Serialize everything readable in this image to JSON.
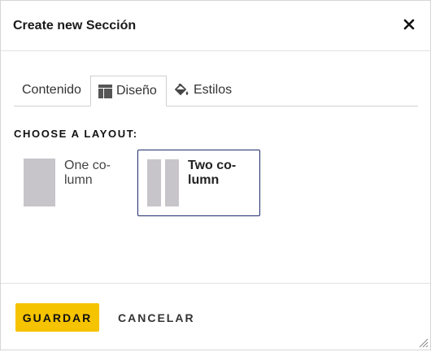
{
  "dialog": {
    "title": "Create new Sección",
    "close_icon": "close-icon"
  },
  "tabs": [
    {
      "label": "Contenido",
      "icon": null
    },
    {
      "label": "Diseño",
      "icon": "layout-icon",
      "active": true
    },
    {
      "label": "Estilos",
      "icon": "paint-bucket-icon"
    }
  ],
  "layout_section": {
    "heading": "CHOOSE A LAYOUT:",
    "options": [
      {
        "line1": "One co-",
        "line2": "lumn",
        "selected": false
      },
      {
        "line1": "Two co-",
        "line2": "lumn",
        "selected": true
      }
    ]
  },
  "footer": {
    "save_label": "GUARDAR",
    "cancel_label": "CANCELAR"
  },
  "colors": {
    "primary_button": "#f6c300",
    "selected_border": "#1f2d6e",
    "placeholder_column": "#c7c5c9"
  }
}
